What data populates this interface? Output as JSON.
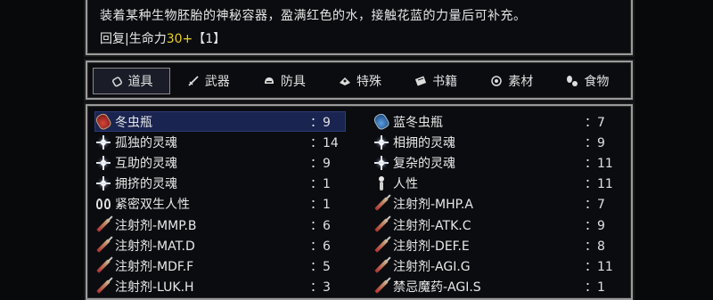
{
  "description": {
    "text": "装着某种生物胚胎的神秘容器，盈满红色的水，接触花蓝的力量后可补充。",
    "effect_prefix": "回复|生命力",
    "effect_value": "30+",
    "effect_suffix": "【1】"
  },
  "tabs": [
    {
      "label": "道具",
      "icon": "pouch-icon",
      "active": true
    },
    {
      "label": "武器",
      "icon": "sword-icon",
      "active": false
    },
    {
      "label": "防具",
      "icon": "helmet-icon",
      "active": false
    },
    {
      "label": "特殊",
      "icon": "special-icon",
      "active": false
    },
    {
      "label": "书籍",
      "icon": "book-icon",
      "active": false
    },
    {
      "label": "素材",
      "icon": "material-icon",
      "active": false
    },
    {
      "label": "食物",
      "icon": "food-icon",
      "active": false
    }
  ],
  "items_left": [
    {
      "name": "冬虫瓶",
      "count": "：9",
      "icon": "red-flask-icon",
      "selected": true
    },
    {
      "name": "孤独的灵魂",
      "count": "：14",
      "icon": "soul-icon"
    },
    {
      "name": "互助的灵魂",
      "count": "：9",
      "icon": "soul-icon"
    },
    {
      "name": "拥挤的灵魂",
      "count": "：1",
      "icon": "soul-icon"
    },
    {
      "name": "紧密双生人性",
      "count": "：1",
      "icon": "twin-humanity-icon"
    },
    {
      "name": "注射剂-MMP.B",
      "count": "：6",
      "icon": "syringe-icon"
    },
    {
      "name": "注射剂-MAT.D",
      "count": "：6",
      "icon": "syringe-icon"
    },
    {
      "name": "注射剂-MDF.F",
      "count": "：5",
      "icon": "syringe-icon"
    },
    {
      "name": "注射剂-LUK.H",
      "count": "：3",
      "icon": "syringe-icon"
    }
  ],
  "items_right": [
    {
      "name": "蓝冬虫瓶",
      "count": "：7",
      "icon": "blue-flask-icon"
    },
    {
      "name": "相拥的灵魂",
      "count": "：9",
      "icon": "soul-icon"
    },
    {
      "name": "复杂的灵魂",
      "count": "：11",
      "icon": "soul-icon"
    },
    {
      "name": "人性",
      "count": "：11",
      "icon": "humanity-icon"
    },
    {
      "name": "注射剂-MHP.A",
      "count": "：7",
      "icon": "syringe-icon"
    },
    {
      "name": "注射剂-ATK.C",
      "count": "：9",
      "icon": "syringe-icon"
    },
    {
      "name": "注射剂-DEF.E",
      "count": "：8",
      "icon": "syringe-icon"
    },
    {
      "name": "注射剂-AGI.G",
      "count": "：11",
      "icon": "syringe-icon"
    },
    {
      "name": "禁忌魔药-AGI.S",
      "count": "：1",
      "icon": "syringe-icon"
    }
  ],
  "colors": {
    "highlight": "#e8d020",
    "selected_row": "#1a2450",
    "border": "#9a9a9a"
  }
}
